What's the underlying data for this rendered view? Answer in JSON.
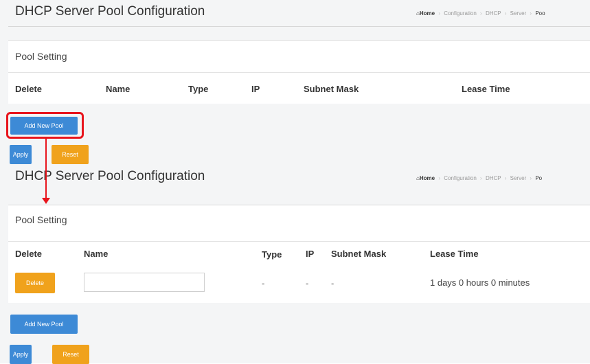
{
  "top": {
    "title": "DHCP Server Pool Configuration",
    "breadcrumb": {
      "home": "Home",
      "items": [
        "Configuration",
        "DHCP",
        "Server",
        "Poo"
      ]
    },
    "section_title": "Pool Setting",
    "columns": [
      "Delete",
      "Name",
      "Type",
      "IP",
      "Subnet Mask",
      "Lease Time"
    ],
    "add_button": "Add New Pool",
    "apply_button": "Apply",
    "reset_button": "Reset"
  },
  "bottom": {
    "title": "DHCP Server Pool Configuration",
    "breadcrumb": {
      "home": "Home",
      "items": [
        "Configuration",
        "DHCP",
        "Server",
        "Po"
      ]
    },
    "section_title": "Pool Setting",
    "columns": [
      "Delete",
      "Name",
      "Type",
      "IP",
      "Subnet Mask",
      "Lease Time"
    ],
    "row": {
      "delete_button": "Delete",
      "name_value": "",
      "type": "-",
      "ip": "-",
      "subnet_mask": "-",
      "lease_time": "1 days 0 hours 0 minutes"
    },
    "add_button": "Add New Pool",
    "apply_button": "Apply",
    "reset_button": "Reset"
  },
  "annotation": {
    "color": "#e8151d"
  },
  "colors": {
    "primary_button": "#3d8ad6",
    "warning_button": "#f0a21c"
  },
  "icons": {
    "home": "home-icon"
  }
}
